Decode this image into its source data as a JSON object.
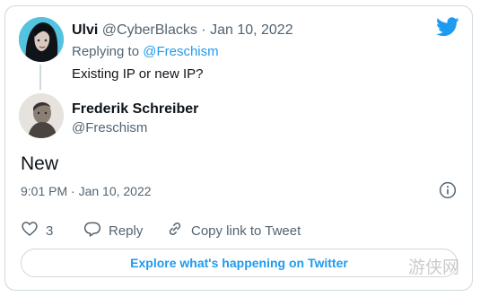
{
  "reply": {
    "name": "Ulvi",
    "handle": "@CyberBlacks",
    "separator": "·",
    "date": "Jan 10, 2022",
    "replying_prefix": "Replying to",
    "replying_to": "@Freschism",
    "text": "Existing IP or new IP?"
  },
  "main": {
    "name": "Frederik Schreiber",
    "handle": "@Freschism",
    "text": "New",
    "timestamp": "9:01 PM · Jan 10, 2022"
  },
  "actions": {
    "like_count": "3",
    "reply_label": "Reply",
    "copy_label": "Copy link to Tweet"
  },
  "explore_label": "Explore what's happening on Twitter",
  "watermark": "游侠网",
  "icons": {
    "brand": "twitter-bird-icon",
    "info": "info-icon",
    "like": "heart-icon",
    "reply": "reply-bubble-icon",
    "copy": "link-icon"
  },
  "colors": {
    "brand": "#1d9bf0",
    "text": "#0f1419",
    "muted": "#536471",
    "border": "#cfd9de"
  }
}
